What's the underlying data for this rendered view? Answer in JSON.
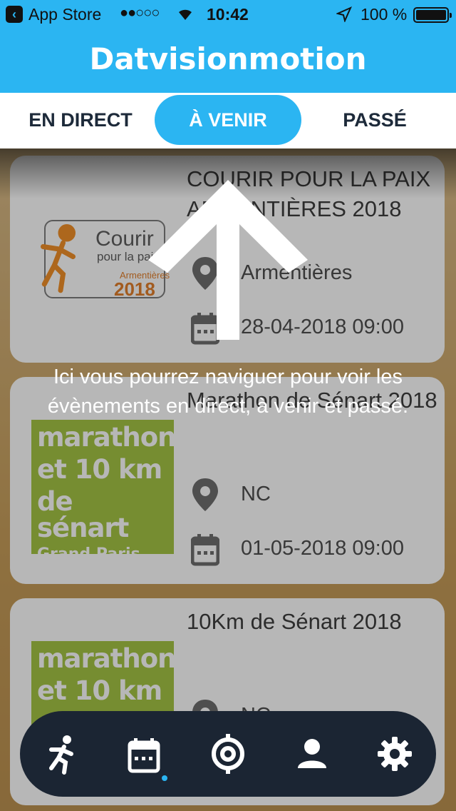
{
  "status_bar": {
    "carrier": "App Store",
    "signal": "●●○○○",
    "time": "10:42",
    "battery": "100 %"
  },
  "header": {
    "logo": "Datvisionmotion"
  },
  "tabs": [
    {
      "label": "EN DIRECT",
      "active": false
    },
    {
      "label": "À VENIR",
      "active": true
    },
    {
      "label": "PASSÉ",
      "active": false
    }
  ],
  "events": [
    {
      "title": "COURIR POUR LA PAIX ARMENTIÈRES 2018",
      "location": "Armentières",
      "date": "28-04-2018 09:00",
      "logo_text": {
        "line1": "Courir",
        "line2": "pour la paix",
        "line3": "Armentières",
        "line4": "2018"
      }
    },
    {
      "title": "Marathon de Sénart 2018",
      "location": "NC",
      "date": "01-05-2018 09:00",
      "logo_text": {
        "line1": "marathon",
        "line2": "et 10 km",
        "line3": "de sénart",
        "line4": "Grand Paris Sud"
      }
    },
    {
      "title": "10Km de Sénart 2018",
      "location": "NC",
      "date": "",
      "logo_text": {
        "line1": "marathon",
        "line2": "et 10 km",
        "line3": "",
        "line4": ""
      }
    }
  ],
  "overlay": {
    "tip": "Ici vous pourrez naviguer pour voir les évènements en direct, à venir et passé."
  },
  "bottom_nav": [
    {
      "icon": "runner-icon"
    },
    {
      "icon": "calendar-icon",
      "active": true
    },
    {
      "icon": "target-icon"
    },
    {
      "icon": "user-icon"
    },
    {
      "icon": "gear-icon"
    }
  ],
  "colors": {
    "primary": "#2bb5f2",
    "nav_bg": "#1b2533",
    "tab_text": "#1d2a3a"
  }
}
